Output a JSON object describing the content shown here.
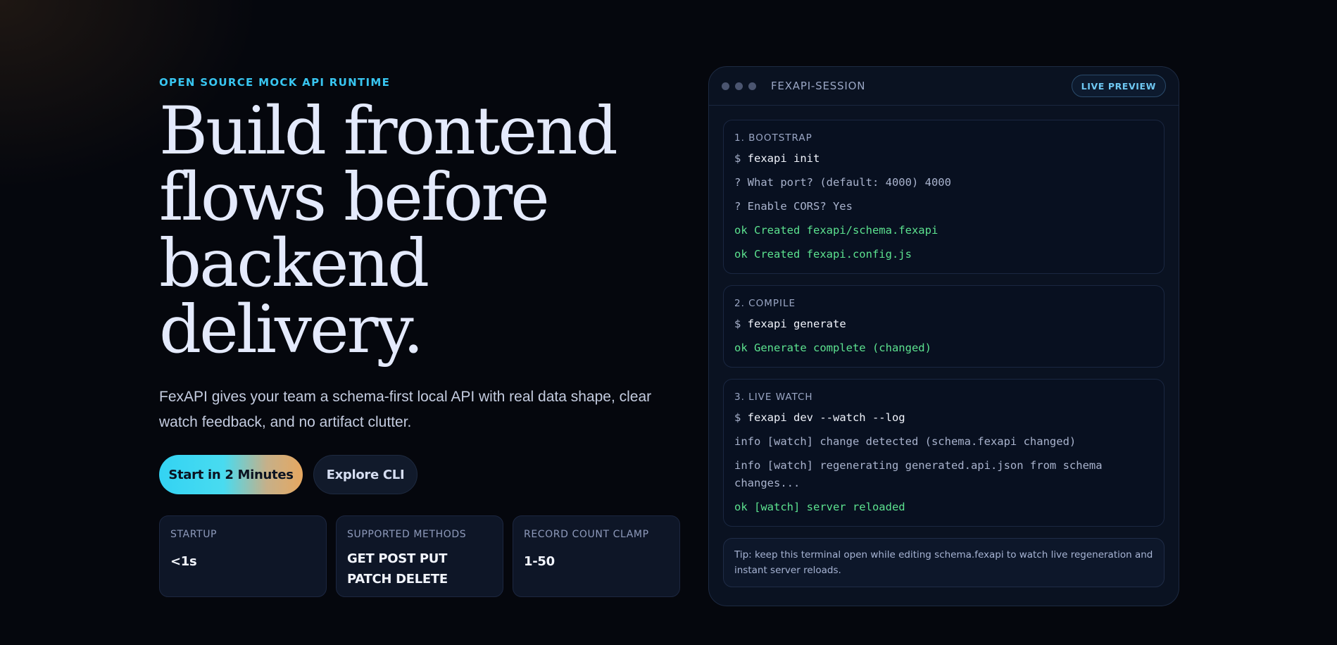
{
  "hero": {
    "eyebrow": "OPEN SOURCE MOCK API RUNTIME",
    "headline_lines": [
      "Build frontend",
      "flows before",
      "backend",
      "delivery."
    ],
    "lede": "FexAPI gives your team a schema-first local API with real data shape, clear watch feedback, and no artifact clutter.",
    "primary_cta": "Start in 2 Minutes",
    "secondary_cta": "Explore CLI",
    "stats": [
      {
        "label": "STARTUP",
        "value": "<1s"
      },
      {
        "label": "SUPPORTED METHODS",
        "value": "GET POST PUT PATCH DELETE"
      },
      {
        "label": "RECORD COUNT CLAMP",
        "value": "1-50"
      }
    ]
  },
  "terminal": {
    "title": "FEXAPI-SESSION",
    "badge": "LIVE PREVIEW",
    "steps": [
      {
        "title": "1. BOOTSTRAP",
        "lines": [
          {
            "prompt": "$ ",
            "text": "fexapi init"
          },
          {
            "text": "? What port? (default: 4000) 4000"
          },
          {
            "text": "? Enable CORS? Yes"
          },
          {
            "text": "ok Created fexapi/schema.fexapi"
          },
          {
            "text": "ok Created fexapi.config.js"
          }
        ]
      },
      {
        "title": "2. COMPILE",
        "lines": [
          {
            "prompt": "$ ",
            "text": "fexapi generate"
          },
          {
            "text": "ok Generate complete (changed)"
          }
        ]
      },
      {
        "title": "3. LIVE WATCH",
        "lines": [
          {
            "prompt": "$ ",
            "text": "fexapi dev --watch --log"
          },
          {
            "text": "info [watch] change detected (schema.fexapi changed)"
          },
          {
            "text": "info [watch] regenerating generated.api.json from schema changes..."
          },
          {
            "text": "ok [watch] server reloaded"
          }
        ]
      }
    ],
    "tip": "Tip: keep this terminal open while editing schema.fexapi to watch live regeneration and instant server reloads."
  },
  "colors": {
    "accent_cyan": "#38c5f0",
    "ok_green": "#5ce28f",
    "background": "#05070d"
  }
}
